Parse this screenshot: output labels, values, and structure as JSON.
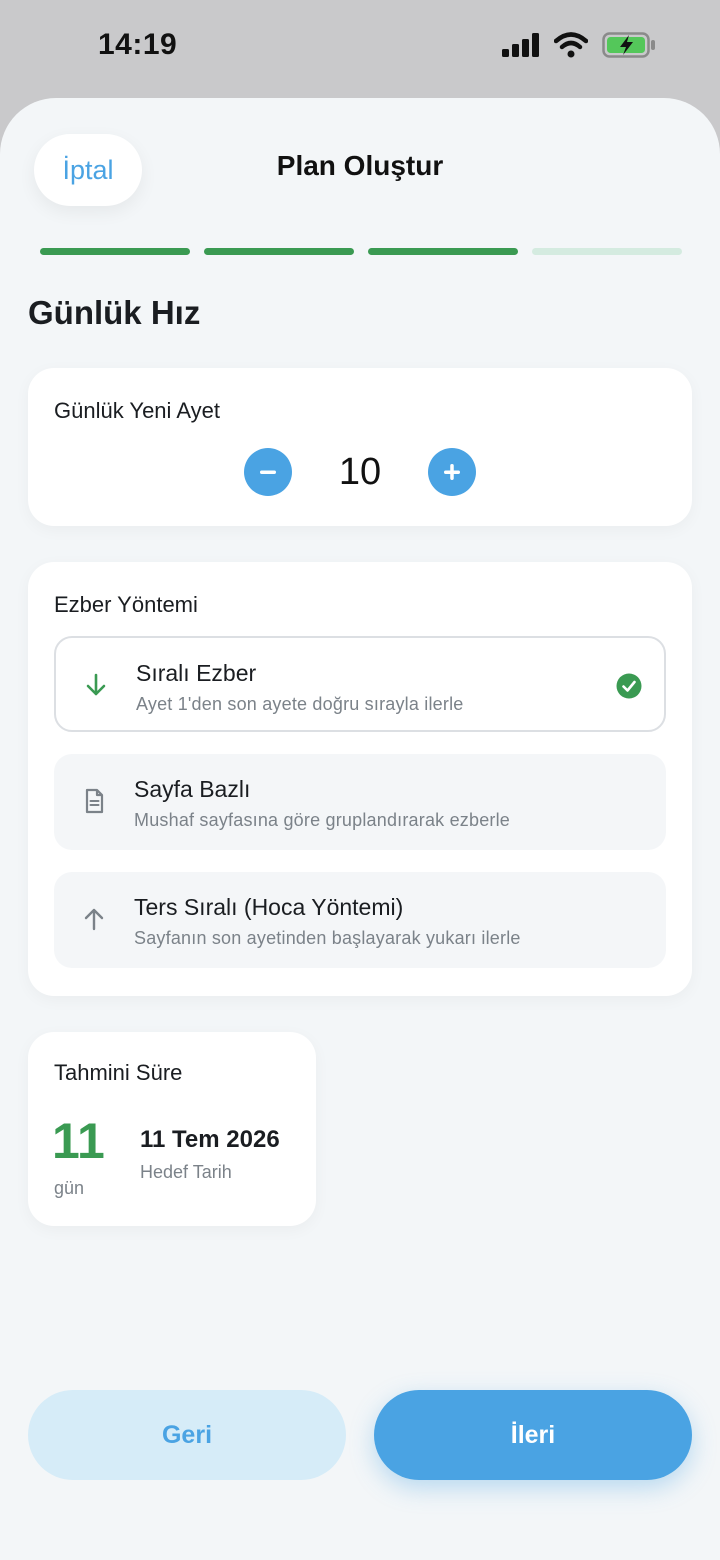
{
  "status_bar": {
    "time": "14:19",
    "icons": [
      "signal-icon",
      "wifi-icon",
      "battery-charging-icon"
    ]
  },
  "header": {
    "cancel_label": "İptal",
    "title": "Plan Oluştur"
  },
  "progress": {
    "steps_total": 4,
    "steps_completed": 3,
    "active_color": "#3a9a52",
    "inactive_color": "#d4ebe0"
  },
  "section_title": "Günlük Hız",
  "daily": {
    "label": "Günlük Yeni Ayet",
    "value": "10",
    "minus_icon": "minus-icon",
    "plus_icon": "plus-icon"
  },
  "method": {
    "label": "Ezber Yöntemi",
    "options": [
      {
        "title": "Sıralı Ezber",
        "desc": "Ayet 1'den son ayete doğru sırayla ilerle",
        "icon": "arrow-down-icon",
        "selected": true
      },
      {
        "title": "Sayfa Bazlı",
        "desc": "Mushaf sayfasına göre gruplandırarak ezberle",
        "icon": "document-icon",
        "selected": false
      },
      {
        "title": "Ters Sıralı (Hoca Yöntemi)",
        "desc": "Sayfanın son ayetinden başlayarak yukarı ilerle",
        "icon": "arrow-up-icon",
        "selected": false
      }
    ]
  },
  "estimate": {
    "label": "Tahmini Süre",
    "days": "11",
    "unit": "gün",
    "target_date": "11 Tem 2026",
    "target_label": "Hedef Tarih"
  },
  "footer": {
    "back_label": "Geri",
    "next_label": "İleri"
  },
  "colors": {
    "accent": "#4aa3e3",
    "success": "#3a9a52"
  }
}
